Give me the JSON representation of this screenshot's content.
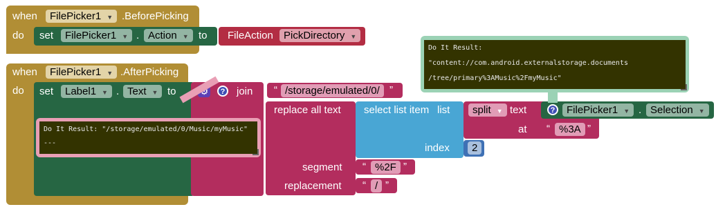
{
  "block1": {
    "when": "when",
    "component": "FilePicker1",
    "event": ".BeforePicking",
    "do": "do",
    "set": "set",
    "target": "FilePicker1",
    "dot": ".",
    "property": "Action",
    "to": "to",
    "enum_name": "FileAction",
    "enum_value": "PickDirectory"
  },
  "block2": {
    "when": "when",
    "component": "FilePicker1",
    "event": ".AfterPicking",
    "do": "do",
    "set": "set",
    "target": "Label1",
    "dot": ".",
    "property": "Text",
    "to": "to",
    "join": "join",
    "string1": "/storage/emulated/0/",
    "replace_all": "replace all text",
    "select_list_item": "select list item",
    "list": "list",
    "split": "split",
    "text_label": "text",
    "picker": "FilePicker1",
    "picker_dot": ".",
    "picker_prop": "Selection",
    "at": "at",
    "at_value": "%3A",
    "index": "index",
    "index_value": "2",
    "segment": "segment",
    "segment_value": "%2F",
    "replacement": "replacement",
    "replacement_value": "/"
  },
  "comment_left": {
    "line1": "Do It Result: \"/storage/emulated/0/Music/myMusic\"",
    "line2": "---"
  },
  "comment_right": {
    "line1": "Do It Result:",
    "line2": "\"content://com.android.externalstorage.documents",
    "line3": "/tree/primary%3AMusic%2FmyMusic\""
  },
  "glyphs": {
    "dropdown": "▼",
    "open_quote": "“",
    "close_quote": "”",
    "help": "?",
    "gear": "⚙"
  }
}
